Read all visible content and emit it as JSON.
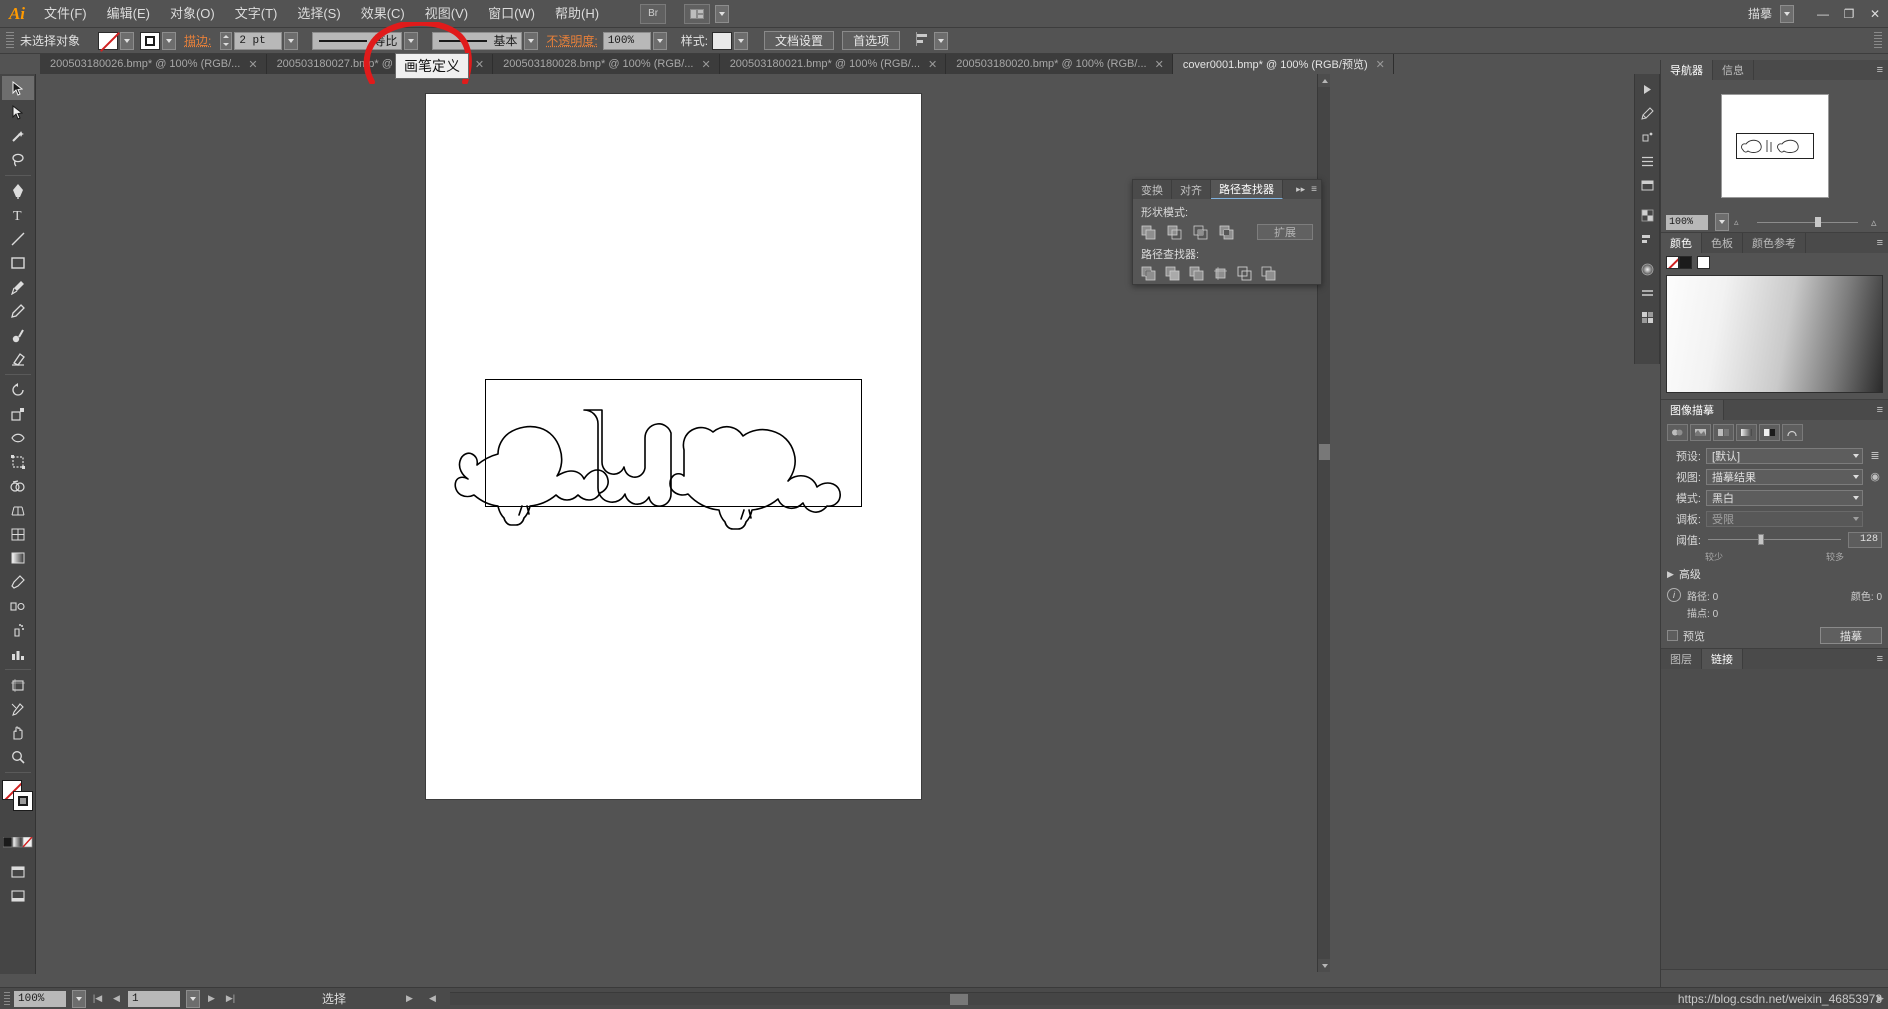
{
  "app": {
    "name": "Ai",
    "menus": [
      "文件(F)",
      "编辑(E)",
      "对象(O)",
      "文字(T)",
      "选择(S)",
      "效果(C)",
      "视图(V)",
      "窗口(W)",
      "帮助(H)"
    ],
    "bridge_label": "Br",
    "arrange_label": "",
    "workspace": "描摹",
    "window_controls": {
      "minimize": "—",
      "restore": "❐",
      "close": "✕"
    }
  },
  "control_bar": {
    "selection_status": "未选择对象",
    "fill_label": "",
    "stroke_label": "描边:",
    "stroke_weight": "2 pt",
    "profile_label": "等比",
    "brush_label": "基本",
    "opacity_label": "不透明度:",
    "opacity_value": "100%",
    "style_label": "样式:",
    "doc_setup_button": "文档设置",
    "preferences_button": "首选项",
    "align_label": "对齐"
  },
  "tooltip": {
    "text": "画笔定义"
  },
  "tabs": [
    {
      "title": "200503180026.bmp* @ 100% (RGB/...",
      "close": "✕",
      "active": false
    },
    {
      "title": "200503180027.bmp* @ 100% (RGB/...",
      "close": "✕",
      "active": false
    },
    {
      "title": "200503180028.bmp* @ 100% (RGB/...",
      "close": "✕",
      "active": false
    },
    {
      "title": "200503180021.bmp* @ 100% (RGB/...",
      "close": "✕",
      "active": false
    },
    {
      "title": "200503180020.bmp* @ 100% (RGB/...",
      "close": "✕",
      "active": false
    },
    {
      "title": "cover0001.bmp* @ 100% (RGB/预览)",
      "close": "✕",
      "active": true
    }
  ],
  "toolbar": {
    "tools": [
      "selection-tool",
      "direct-selection-tool",
      "magic-wand-tool",
      "lasso-tool",
      "pen-tool",
      "type-tool",
      "line-tool",
      "rectangle-tool",
      "paintbrush-tool",
      "pencil-tool",
      "blob-brush-tool",
      "eraser-tool",
      "rotate-tool",
      "scale-tool",
      "width-tool",
      "free-transform-tool",
      "shape-builder-tool",
      "perspective-grid-tool",
      "mesh-tool",
      "gradient-tool",
      "eyedropper-tool",
      "blend-tool",
      "symbol-sprayer-tool",
      "column-graph-tool",
      "artboard-tool",
      "slice-tool",
      "hand-tool",
      "zoom-tool"
    ]
  },
  "pathfinder_panel": {
    "tabs": [
      "变换",
      "对齐",
      "路径查找器"
    ],
    "active_tab": "路径查找器",
    "shape_modes_label": "形状模式:",
    "expand_button": "扩展",
    "pathfinders_label": "路径查找器:",
    "collapse_icon": "▸▸",
    "menu_icon": "≡"
  },
  "right_dock": {
    "navigator": {
      "tabs": [
        "导航器",
        "信息"
      ],
      "active_tab": "导航器",
      "zoom_value": "100%"
    },
    "color": {
      "tabs": [
        "颜色",
        "色板",
        "颜色参考"
      ],
      "active_tab": "颜色"
    },
    "image_trace": {
      "title": "图像描摹",
      "preset_label": "预设:",
      "preset_value": "[默认]",
      "view_label": "视图:",
      "view_value": "描摹结果",
      "mode_label": "模式:",
      "mode_value": "黑白",
      "palette_label": "调板:",
      "palette_value": "受限",
      "threshold_label": "阈值:",
      "threshold_value": "128",
      "threshold_min": "较少",
      "threshold_max": "较多",
      "advanced_label": "高级",
      "paths_label": "路径:",
      "paths_value": "0",
      "colors_label": "颜色:",
      "colors_value": "0",
      "anchors_label": "描点:",
      "anchors_value": "0",
      "preview_label": "预览",
      "trace_button": "描摹"
    },
    "layers": {
      "tabs": [
        "图层",
        "链接"
      ],
      "active_tab": "链接"
    }
  },
  "status_bar": {
    "zoom": "100%",
    "page": "1",
    "status_text": "选择"
  },
  "watermark": {
    "text": "https://blog.csdn.net/weixin_46853973"
  },
  "colors": {
    "accent_orange": "#e8803a",
    "logo_orange": "#ff9a00",
    "panel_bg": "#535353",
    "dark_bg": "#3c3c3c",
    "annotation_red": "#e01b1b"
  }
}
